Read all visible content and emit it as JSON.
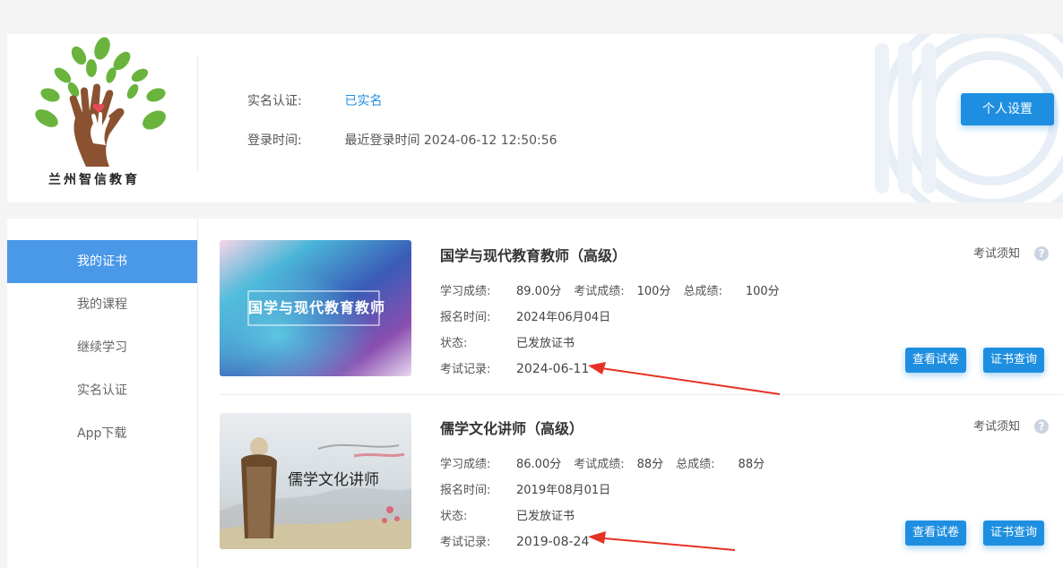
{
  "brand": {
    "logo_text": "兰州智信教育"
  },
  "profile": {
    "realname_label": "实名认证:",
    "realname_value": "已实名",
    "login_label": "登录时间:",
    "login_value": "最近登录时间 2024-06-12 12:50:56",
    "settings_button": "个人设置"
  },
  "sidebar": {
    "items": [
      {
        "label": "我的证书",
        "active": true
      },
      {
        "label": "我的课程",
        "active": false
      },
      {
        "label": "继续学习",
        "active": false
      },
      {
        "label": "实名认证",
        "active": false
      },
      {
        "label": "App下载",
        "active": false
      }
    ]
  },
  "certificates": [
    {
      "thumbnail_text": "国学与现代教育教师",
      "title": "国学与现代教育教师（高级）",
      "notice": "考试须知",
      "study_label": "学习成绩:",
      "study_score": "89.00分",
      "exam_label": "考试成绩:",
      "exam_score": "100分",
      "total_label": "总成绩:",
      "total_score": "100分",
      "enroll_label": "报名时间:",
      "enroll_date": "2024年06月04日",
      "status_label": "状态:",
      "status": "已发放证书",
      "record_label": "考试记录:",
      "record_date": "2024-06-11",
      "view_button": "查看试卷",
      "query_button": "证书查询"
    },
    {
      "thumbnail_text": "儒学文化讲师",
      "title": "儒学文化讲师（高级）",
      "notice": "考试须知",
      "study_label": "学习成绩:",
      "study_score": "86.00分",
      "exam_label": "考试成绩:",
      "exam_score": "88分",
      "total_label": "总成绩:",
      "total_score": "88分",
      "enroll_label": "报名时间:",
      "enroll_date": "2019年08月01日",
      "status_label": "状态:",
      "status": "已发放证书",
      "record_label": "考试记录:",
      "record_date": "2019-08-24",
      "view_button": "查看试卷",
      "query_button": "证书查询"
    }
  ],
  "colors": {
    "accent": "#1e8fe0",
    "sidebar_active": "#4a98e8",
    "annotation_arrow": "#e53225"
  }
}
